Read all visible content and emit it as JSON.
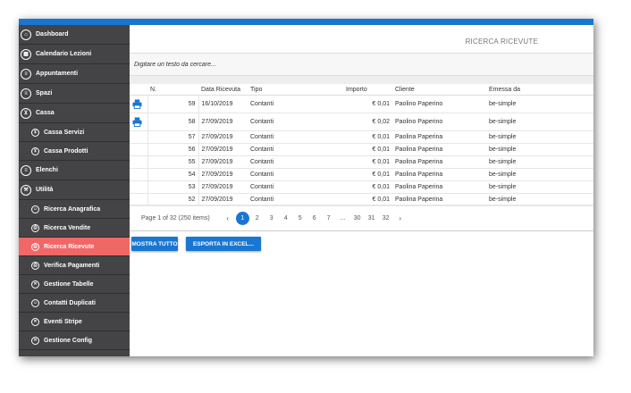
{
  "colors": {
    "accent": "#1976d2",
    "sidebar_bg": "#444446",
    "sidebar_active": "#f06767"
  },
  "sidebar": {
    "items": [
      {
        "label": "Dashboard",
        "icon": "home-icon",
        "level": "main"
      },
      {
        "label": "Calendario Lezioni",
        "icon": "calendar-icon",
        "level": "main"
      },
      {
        "label": "Appuntamenti",
        "icon": "list-icon",
        "level": "main"
      },
      {
        "label": "Spazi",
        "icon": "list-icon",
        "level": "main"
      },
      {
        "label": "Cassa",
        "icon": "cart-icon",
        "level": "main"
      },
      {
        "label": "Cassa Servizi",
        "icon": "cart-icon",
        "level": "sub"
      },
      {
        "label": "Cassa Prodotti",
        "icon": "cart-icon",
        "level": "sub"
      },
      {
        "label": "Elenchi",
        "icon": "menu-icon",
        "level": "main"
      },
      {
        "label": "Utilità",
        "icon": "wrench-icon",
        "level": "main"
      },
      {
        "label": "Ricerca Anagrafica",
        "icon": "people-icon",
        "level": "sub"
      },
      {
        "label": "Ricerca Vendite",
        "icon": "printer-icon",
        "level": "sub"
      },
      {
        "label": "Ricerca Ricevute",
        "icon": "printer-icon",
        "level": "sub",
        "active": true
      },
      {
        "label": "Verifica Pagamenti",
        "icon": "printer-icon",
        "level": "sub"
      },
      {
        "label": "Gestione Tabelle",
        "icon": "tools-icon",
        "level": "sub"
      },
      {
        "label": "Contatti Duplicati",
        "icon": "people-icon",
        "level": "sub"
      },
      {
        "label": "Eventi Stripe",
        "icon": "tools-icon",
        "level": "sub"
      },
      {
        "label": "Gestione Config",
        "icon": "tools-icon",
        "level": "sub"
      }
    ]
  },
  "main": {
    "title": "RICERCA RICEVUTE",
    "search": {
      "placeholder": "Digitare un testo da cercare...",
      "value": ""
    },
    "table": {
      "columns": [
        "",
        "N.",
        "Data Ricevuta",
        "Tipo",
        "Importo",
        "Cliente",
        "Emessa da"
      ],
      "rows": [
        {
          "n": "59",
          "data": "16/10/2019",
          "tipo": "Contanti",
          "importo": "€ 0,01",
          "cliente": "Paolino Paperino",
          "emessa": "be-simple",
          "printer": true
        },
        {
          "n": "58",
          "data": "27/09/2019",
          "tipo": "Contanti",
          "importo": "€ 0,02",
          "cliente": "Paolino Paperino",
          "emessa": "be-simple",
          "printer": true
        },
        {
          "n": "57",
          "data": "27/09/2019",
          "tipo": "Contanti",
          "importo": "€ 0,01",
          "cliente": "Paolina Paperina",
          "emessa": "be-simple",
          "printer": false
        },
        {
          "n": "56",
          "data": "27/09/2019",
          "tipo": "Contanti",
          "importo": "€ 0,01",
          "cliente": "Paolina Paperina",
          "emessa": "be-simple",
          "printer": false
        },
        {
          "n": "55",
          "data": "27/09/2019",
          "tipo": "Contanti",
          "importo": "€ 0,01",
          "cliente": "Paolina Paperina",
          "emessa": "be-simple",
          "printer": false
        },
        {
          "n": "54",
          "data": "27/09/2019",
          "tipo": "Contanti",
          "importo": "€ 0,01",
          "cliente": "Paolina Paperina",
          "emessa": "be-simple",
          "printer": false
        },
        {
          "n": "53",
          "data": "27/09/2019",
          "tipo": "Contanti",
          "importo": "€ 0,01",
          "cliente": "Paolina Paperina",
          "emessa": "be-simple",
          "printer": false
        },
        {
          "n": "52",
          "data": "27/09/2019",
          "tipo": "Contanti",
          "importo": "€ 0,01",
          "cliente": "Paolina Paperina",
          "emessa": "be-simple",
          "printer": false
        }
      ]
    },
    "pager": {
      "info": "Page 1 of 32 (250 items)",
      "prev": "‹",
      "next": "›",
      "pages": [
        "1",
        "2",
        "3",
        "4",
        "5",
        "6",
        "7",
        "...",
        "30",
        "31",
        "32"
      ],
      "current": "1"
    },
    "actions": {
      "show_all": "MOSTRA TUTTO",
      "export": "ESPORTA IN EXCEL..."
    }
  }
}
